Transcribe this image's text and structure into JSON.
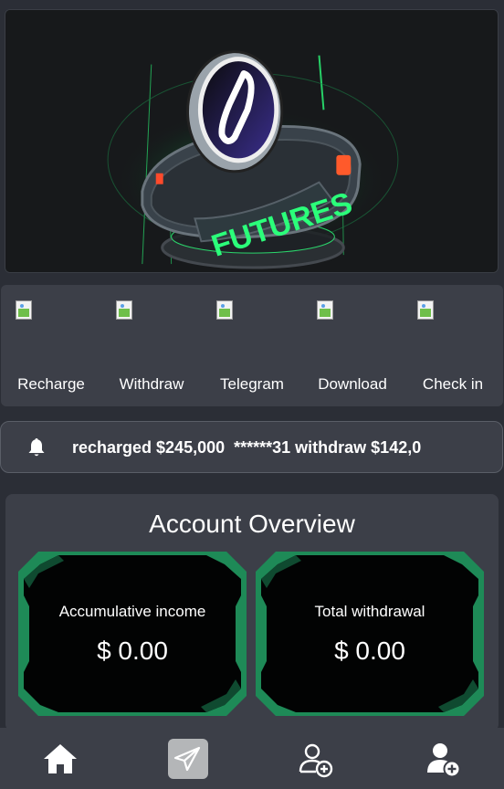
{
  "banner": {
    "logo_text": "FUTURES",
    "coin_icon": "futures-coin-icon"
  },
  "actions": [
    {
      "label": "Recharge",
      "icon": "recharge-icon"
    },
    {
      "label": "Withdraw",
      "icon": "withdraw-icon"
    },
    {
      "label": "Telegram",
      "icon": "telegram-icon"
    },
    {
      "label": "Download",
      "icon": "download-icon"
    },
    {
      "label": "Check in",
      "icon": "check-in-icon"
    }
  ],
  "ticker": {
    "icon": "bell-icon",
    "text": "recharged $245,000  ******31 withdraw $142,0"
  },
  "overview": {
    "title": "Account Overview",
    "cards": [
      {
        "label": "Accumulative income",
        "value": "$ 0.00"
      },
      {
        "label": "Total withdrawal",
        "value": "$ 0.00"
      }
    ]
  },
  "nav": [
    {
      "label": "",
      "icon": "home-icon"
    },
    {
      "label": "",
      "icon": "paper-plane-icon"
    },
    {
      "label": "",
      "icon": "add-user-outline-icon"
    },
    {
      "label": "",
      "icon": "add-user-filled-icon"
    }
  ],
  "colors": {
    "background": "#2b2e36",
    "panel": "#3c3f48",
    "accent_green": "#1e8a57",
    "neon_green": "#2bff7a"
  }
}
